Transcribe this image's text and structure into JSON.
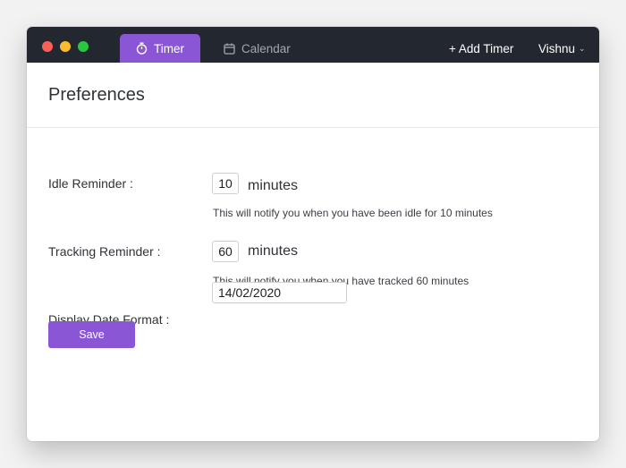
{
  "titlebar": {
    "tabs": [
      {
        "label": "Timer",
        "icon": "stopwatch-icon",
        "active": true
      },
      {
        "label": "Calendar",
        "icon": "calendar-icon",
        "active": false
      }
    ],
    "add_timer_label": "+ Add Timer",
    "user_name": "Vishnu",
    "user_menu_icon": "chevron-down-icon"
  },
  "main": {
    "title": "Preferences",
    "idle_reminder": {
      "label": "Idle Reminder :",
      "value": "10",
      "unit": "minutes",
      "help": "This will notify you when you have been idle for 10 minutes"
    },
    "tracking_reminder": {
      "label": "Tracking Reminder :",
      "value": "60",
      "unit": "minutes",
      "help": "This will notify you when you have tracked 60 minutes"
    },
    "date_format": {
      "label": "Display Date Format :",
      "value": "14/02/2020"
    },
    "save_label": "Save"
  },
  "colors": {
    "accent": "#8a56d6",
    "titlebar": "#232830",
    "close": "#fc5f57",
    "minimize": "#fdbc2e",
    "maximize": "#28c840"
  }
}
